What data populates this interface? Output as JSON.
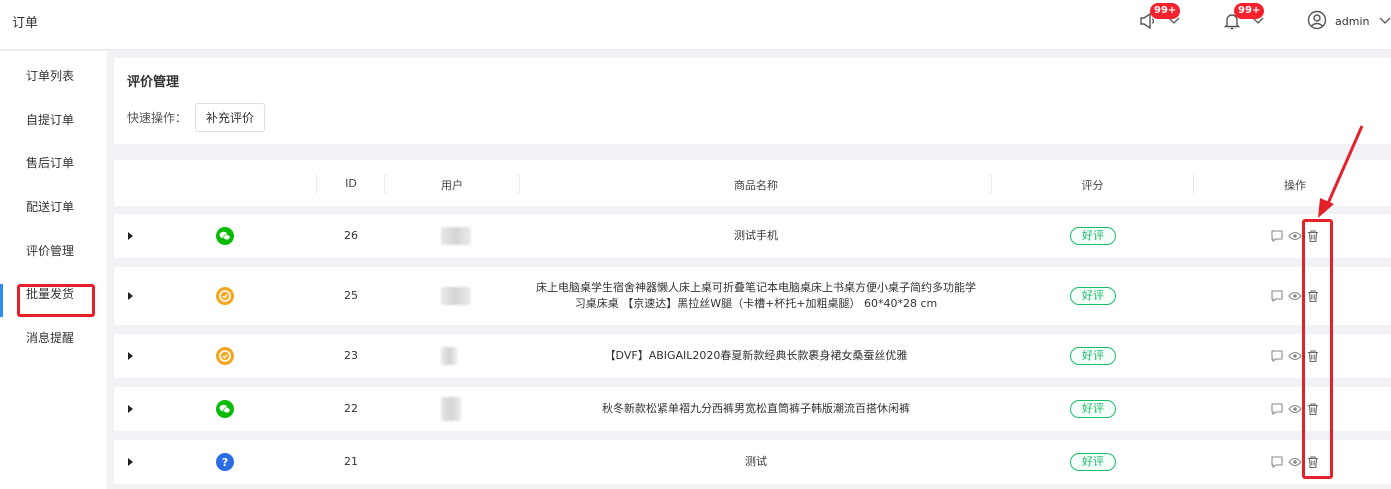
{
  "header": {
    "title": "订单",
    "notice_badge": "99+",
    "bell_badge": "99+",
    "user_name": "admin"
  },
  "sidebar": {
    "items": [
      {
        "label": "订单列表"
      },
      {
        "label": "自提订单"
      },
      {
        "label": "售后订单"
      },
      {
        "label": "配送订单"
      },
      {
        "label": "评价管理",
        "active": true
      },
      {
        "label": "批量发货"
      },
      {
        "label": "消息提醒"
      }
    ]
  },
  "page": {
    "title": "评价管理",
    "quick_label": "快速操作：",
    "quick_button": "补充评价"
  },
  "table": {
    "columns": [
      "ID",
      "用户",
      "商品名称",
      "评分",
      "操作"
    ],
    "rows": [
      {
        "source_icon": "wechat-icon",
        "id": "26",
        "product": "测试手机",
        "rating": "好评"
      },
      {
        "source_icon": "miniprogram-icon",
        "id": "25",
        "product": "床上电脑桌学生宿舍神器懒人床上桌可折叠笔记本电脑桌床上书桌方便小桌子简约多功能学习桌床桌 【京速达】黑拉丝W腿（卡槽+杯托+加粗桌腿） 60*40*28 cm",
        "rating": "好评"
      },
      {
        "source_icon": "miniprogram-icon",
        "id": "23",
        "product": "【DVF】ABIGAIL2020春夏新款经典长款裹身裙女桑蚕丝优雅",
        "rating": "好评"
      },
      {
        "source_icon": "wechat-icon",
        "id": "22",
        "product": "秋冬新款松紧单褶九分西裤男宽松直筒裤子韩版潮流百搭休闲裤",
        "rating": "好评"
      },
      {
        "source_icon": "help-icon",
        "id": "21",
        "product": "测试",
        "rating": "好评"
      }
    ]
  },
  "colors": {
    "accent_green": "#19be6b",
    "wechat_green": "#09bb07",
    "miniprogram_orange": "#f5a623",
    "help_blue": "#2b6de5",
    "annotation_red": "#e4202b"
  }
}
